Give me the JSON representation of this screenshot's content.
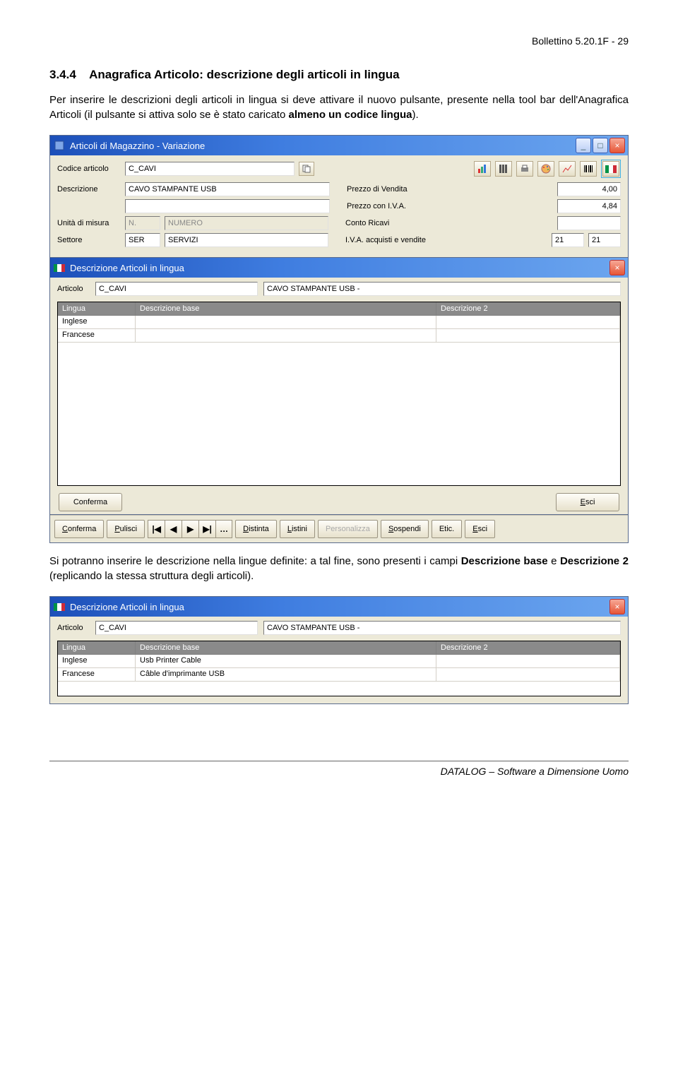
{
  "header": {
    "right": "Bollettino 5.20.1F - 29"
  },
  "section": {
    "number": "3.4.4",
    "title": "Anagrafica Articolo: descrizione degli articoli in lingua"
  },
  "para1_a": "Per inserire le descrizioni degli articoli in lingua si deve attivare il nuovo pulsante, presente nella tool bar dell'Anagrafica Articoli (il pulsante si attiva solo se è stato caricato ",
  "para1_b": "almeno un codice lingua",
  "para1_c": ").",
  "win1": {
    "title": "Articoli di Magazzino - Variazione",
    "labels": {
      "codice": "Codice articolo",
      "descr": "Descrizione",
      "unita": "Unità di misura",
      "settore": "Settore",
      "prezzo_v": "Prezzo di Vendita",
      "prezzo_iva": "Prezzo con I.V.A.",
      "conto": "Conto Ricavi",
      "iva": "I.V.A. acquisti e vendite"
    },
    "values": {
      "codice": "C_CAVI",
      "descr1": "CAVO STAMPANTE USB",
      "descr2": "",
      "unita_code": "N.",
      "unita_desc": "NUMERO",
      "settore_code": "SER",
      "settore_desc": "SERVIZI",
      "prezzo_v": "4,00",
      "prezzo_iva": "4,84",
      "conto": "",
      "iva1": "21",
      "iva2": "21"
    },
    "buttons": {
      "conferma": "Conferma",
      "pulisci": "Pulisci",
      "distinta": "Distinta",
      "listini": "Listini",
      "personalizza": "Personalizza",
      "sospendi": "Sospendi",
      "etic": "Etic.",
      "esci": "Esci"
    }
  },
  "win2": {
    "title": "Descrizione Articoli in lingua",
    "article_label": "Articolo",
    "article_code": "C_CAVI",
    "article_desc": "CAVO STAMPANTE USB -",
    "headers": {
      "lingua": "Lingua",
      "descbase": "Descrizione base",
      "desc2": "Descrizione 2"
    },
    "rows": [
      {
        "lingua": "Inglese",
        "descbase": "",
        "desc2": ""
      },
      {
        "lingua": "Francese",
        "descbase": "",
        "desc2": ""
      }
    ],
    "buttons": {
      "conferma": "Conferma",
      "esci": "Esci"
    }
  },
  "para2_a": "Si potranno inserire le descrizione nella lingue definite: a tal fine, sono presenti i campi ",
  "para2_b": "Descrizione base",
  "para2_c": " e ",
  "para2_d": "Descrizione 2",
  "para2_e": " (replicando la stessa struttura degli articoli).",
  "win3": {
    "title": "Descrizione Articoli in lingua",
    "article_label": "Articolo",
    "article_code": "C_CAVI",
    "article_desc": "CAVO STAMPANTE USB -",
    "headers": {
      "lingua": "Lingua",
      "descbase": "Descrizione base",
      "desc2": "Descrizione 2"
    },
    "rows": [
      {
        "lingua": "Inglese",
        "descbase": "Usb Printer Cable",
        "desc2": ""
      },
      {
        "lingua": "Francese",
        "descbase": "Câble d'imprimante USB",
        "desc2": ""
      }
    ]
  },
  "footer": "DATALOG – Software a Dimensione Uomo"
}
